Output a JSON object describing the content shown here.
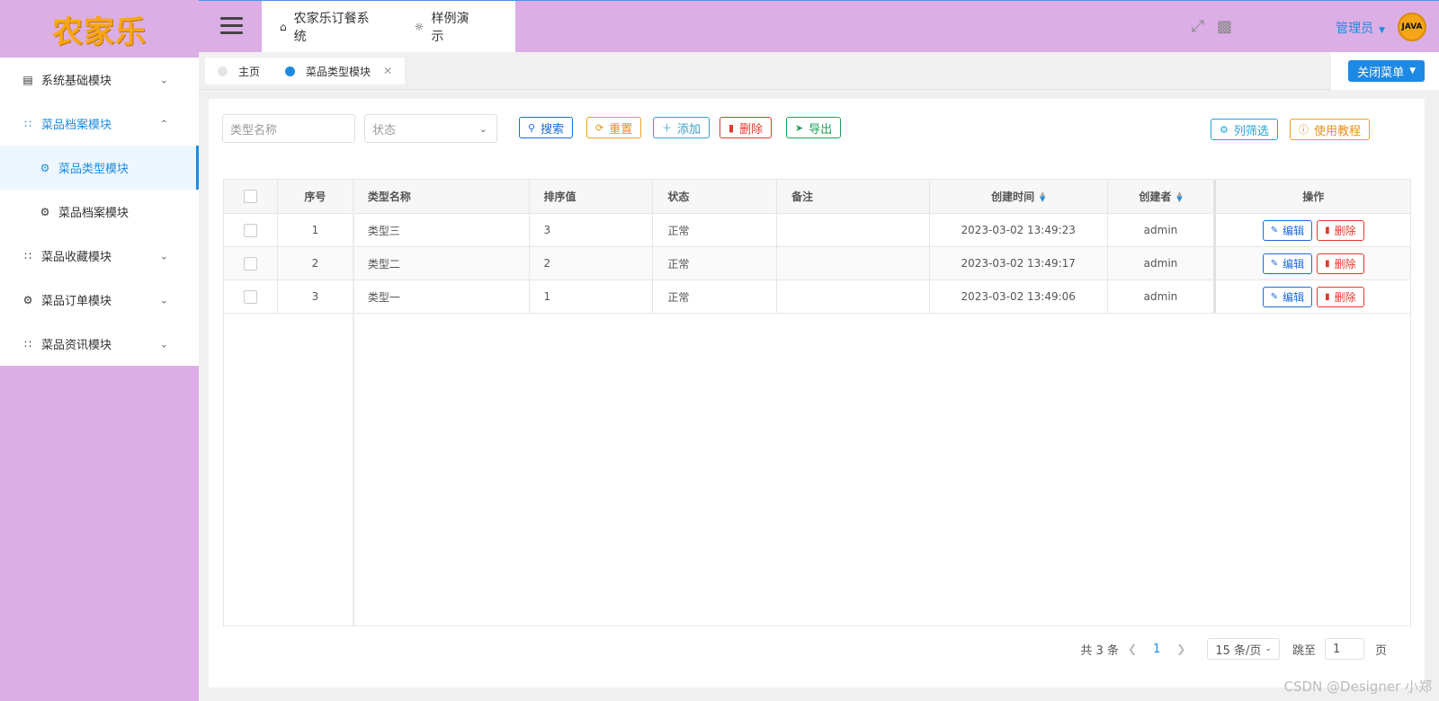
{
  "app": {
    "logo": "农家乐"
  },
  "sidebar": {
    "items": [
      {
        "label": "系统基础模块",
        "icon": "chart-icon",
        "level": 1,
        "state": "collapsed"
      },
      {
        "label": "菜品档案模块",
        "icon": "grid-icon",
        "level": 1,
        "state": "expanded"
      },
      {
        "label": "菜品类型模块",
        "icon": "gear-icon",
        "level": 2,
        "state": "active"
      },
      {
        "label": "菜品档案模块",
        "icon": "gear-icon",
        "level": 2,
        "state": "normal"
      },
      {
        "label": "菜品收藏模块",
        "icon": "grid-icon",
        "level": 1,
        "state": "collapsed"
      },
      {
        "label": "菜品订单模块",
        "icon": "gear-icon",
        "level": 1,
        "state": "collapsed"
      },
      {
        "label": "菜品资讯模块",
        "icon": "grid-icon",
        "level": 1,
        "state": "collapsed"
      }
    ]
  },
  "topbar": {
    "nav": [
      {
        "label": "农家乐订餐系统",
        "icon": "home-icon"
      },
      {
        "label": "样例演示",
        "icon": "bulb-icon"
      }
    ],
    "user": "管理员",
    "avatar_text": "JAVA"
  },
  "tabs": [
    {
      "label": "主页",
      "active": false
    },
    {
      "label": "菜品类型模块",
      "active": true
    }
  ],
  "close_menu_label": "关闭菜单",
  "filters": {
    "name_placeholder": "类型名称",
    "status_placeholder": "状态"
  },
  "toolbar": {
    "search": "搜索",
    "reset": "重置",
    "add": "添加",
    "delete": "删除",
    "export": "导出",
    "column_filter": "列筛选",
    "tutorial": "使用教程"
  },
  "table": {
    "headers": {
      "index": "序号",
      "name": "类型名称",
      "sort": "排序值",
      "status": "状态",
      "note": "备注",
      "created_at": "创建时间",
      "creator": "创建者",
      "ops": "操作"
    },
    "rows": [
      {
        "index": "1",
        "name": "类型三",
        "sort": "3",
        "status": "正常",
        "note": "",
        "created_at": "2023-03-02 13:49:23",
        "creator": "admin"
      },
      {
        "index": "2",
        "name": "类型二",
        "sort": "2",
        "status": "正常",
        "note": "",
        "created_at": "2023-03-02 13:49:17",
        "creator": "admin"
      },
      {
        "index": "3",
        "name": "类型一",
        "sort": "1",
        "status": "正常",
        "note": "",
        "created_at": "2023-03-02 13:49:06",
        "creator": "admin"
      }
    ],
    "edit_label": "编辑",
    "delete_label": "删除"
  },
  "pagination": {
    "total": "共 3 条",
    "current_page": "1",
    "page_size": "15 条/页",
    "jump_label": "跳至",
    "jump_value": "1",
    "page_suffix": "页"
  },
  "watermark": "CSDN @Designer 小郑",
  "colors": {
    "accent": "#1d8ce0",
    "header_bg": "#dcaee6",
    "logo": "#f7a614",
    "danger": "#e23a2a",
    "warning": "#f0a020",
    "success": "#22a05a"
  }
}
